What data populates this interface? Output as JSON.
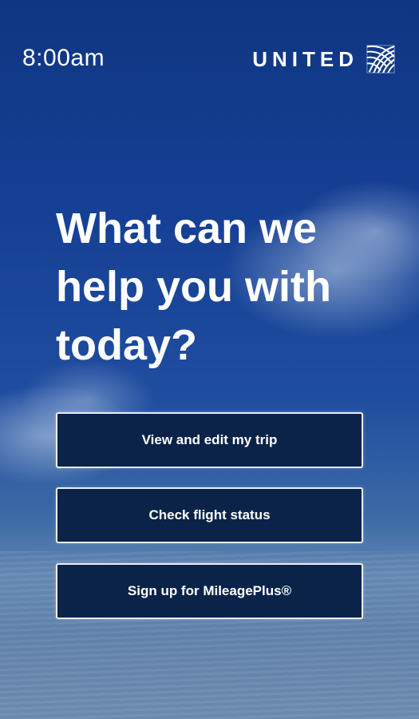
{
  "status_bar": {
    "time": "8:00am"
  },
  "brand": {
    "name": "UNITED",
    "logo_icon": "globe-icon"
  },
  "headline": "What can we help you with today?",
  "actions": [
    {
      "label": "View and edit my trip"
    },
    {
      "label": "Check flight status"
    },
    {
      "label": "Sign up for MileagePlus®"
    }
  ],
  "colors": {
    "sky_top": "#0f3683",
    "button_bg": "#0b2349",
    "button_border": "#e7edf6",
    "text": "#ffffff"
  }
}
